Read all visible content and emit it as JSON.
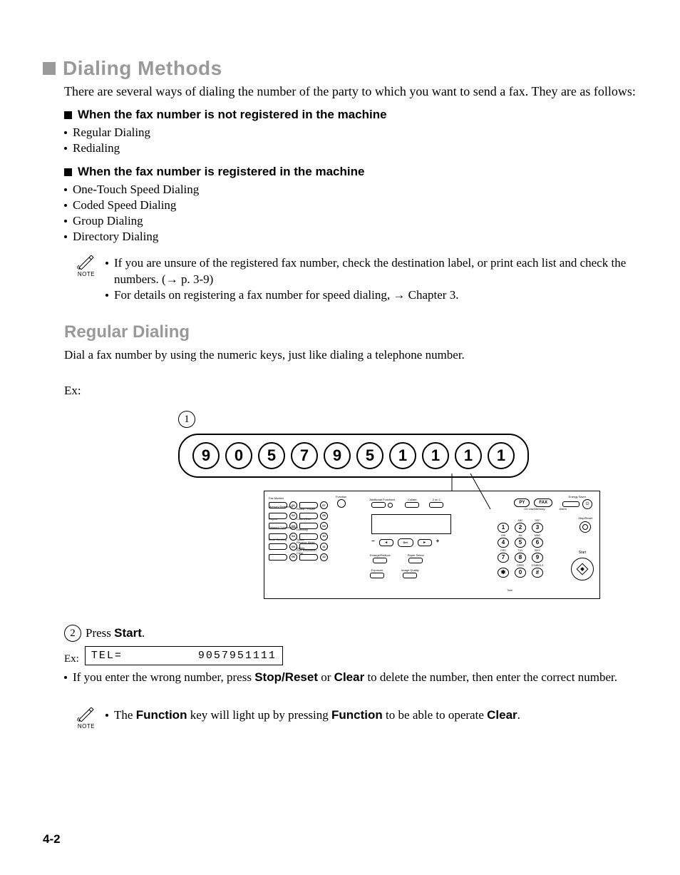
{
  "h1": "Dialing Methods",
  "intro": "There are several ways of dialing the number of the party to which you want to send a fax. They are as follows:",
  "h3_not_registered": "When the fax number is not registered in the machine",
  "not_registered_items": [
    "Regular Dialing",
    "Redialing"
  ],
  "h3_registered": "When the fax number is registered in the machine",
  "registered_items": [
    "One-Touch Speed Dialing",
    "Coded Speed Dialing",
    "Group Dialing",
    "Directory Dialing"
  ],
  "note_label": "NOTE",
  "note1_a": "If you are unsure of the registered fax number, check the destination label, or print each list and check the numbers. (",
  "note1_arrow": "→",
  "note1_b": " p. 3-9)",
  "note2_a": "For details on registering a fax number for speed dialing, ",
  "note2_arrow": "→",
  "note2_b": " Chapter 3.",
  "h2": "Regular Dialing",
  "body1": "Dial a fax number by using the numeric keys, just like dialing a telephone number.",
  "ex": "Ex:",
  "step1": "1",
  "digits": [
    "9",
    "0",
    "5",
    "7",
    "9",
    "5",
    "1",
    "1",
    "1",
    "1"
  ],
  "panel": {
    "one_touch_left": [
      {
        "num": "01",
        "label": "Fax Monitor"
      },
      {
        "num": "02",
        "label": "Memory\nReference"
      },
      {
        "num": "03",
        "label": "Report"
      },
      {
        "num": "04",
        "label": "Delayed\nTransmission"
      },
      {
        "num": "05",
        "label": "Book Sending"
      },
      {
        "num": "06",
        "label": ""
      }
    ],
    "one_touch_right": [
      {
        "num": "07",
        "label": ""
      },
      {
        "num": "08",
        "label": "Redial / Pause"
      },
      {
        "num": "09",
        "label": "Coded Dial"
      },
      {
        "num": "10",
        "label": "+\nDirectory"
      },
      {
        "num": "11",
        "label": "Space\nReceive Mode"
      },
      {
        "num": "12",
        "label": "Delete\nFAX Resolution\nClear"
      }
    ],
    "fn_function": "Function",
    "fn_additional": "Additional Functions",
    "fn_collate": "Collate",
    "fn_2on1": "2 on 1",
    "set": "Set",
    "enlarge": "Enlarge/Reduce",
    "paper": "Paper Select",
    "exposure": "Exposure",
    "imageq": "Image Quality",
    "copy": "PY",
    "fax": "FAX",
    "energy": "Energy Saver",
    "onuse": "On Use/Memory",
    "alarm": "Alarm",
    "stop": "Stop/Reset",
    "start": "Start",
    "keys": [
      {
        "d": "1",
        "l": ""
      },
      {
        "d": "2",
        "l": "ABC"
      },
      {
        "d": "3",
        "l": "DEF"
      },
      {
        "d": "4",
        "l": "GHI"
      },
      {
        "d": "5",
        "l": "JKL"
      },
      {
        "d": "6",
        "l": "MNO"
      },
      {
        "d": "7",
        "l": "PRS"
      },
      {
        "d": "8",
        "l": "TUV"
      },
      {
        "d": "9",
        "l": "WXY"
      },
      {
        "d": "✱",
        "l": ""
      },
      {
        "d": "0",
        "l": "OPER"
      },
      {
        "d": "#",
        "l": "SYMBOLS"
      }
    ],
    "tone": "Tone"
  },
  "step2_num": "2",
  "step2_a": "Press ",
  "step2_b": "Start",
  "step2_c": ".",
  "lcd_left": "TEL=",
  "lcd_right": "9057951111",
  "ex2": "Ex:",
  "wrong_a": "If you enter the wrong number, press ",
  "wrong_b": "Stop/Reset",
  "wrong_c": " or ",
  "wrong_d": "Clear",
  "wrong_e": " to delete the number, then enter the correct number.",
  "note3_a": "The ",
  "note3_b": "Function",
  "note3_c": " key will light up by pressing ",
  "note3_d": "Function",
  "note3_e": " to be able to operate ",
  "note3_f": "Clear",
  "note3_g": ".",
  "page_num": "4-2"
}
